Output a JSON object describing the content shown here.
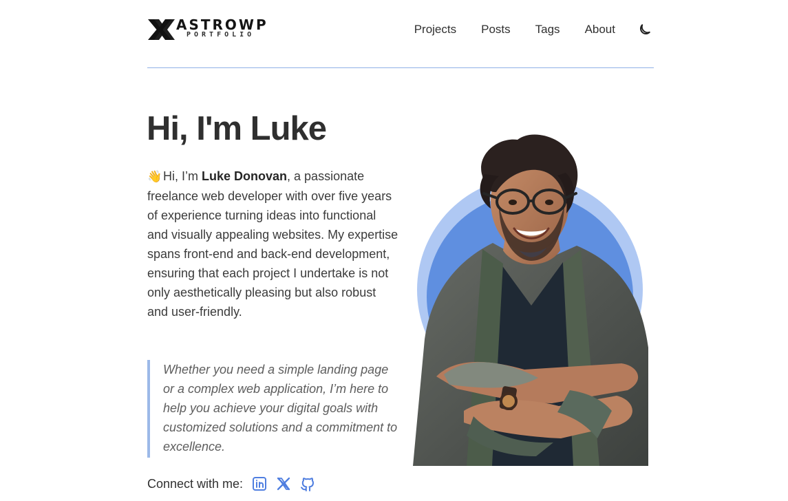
{
  "header": {
    "logo": {
      "mark": "X",
      "title": "ASTROWP",
      "subtitle": "PORTFOLIO"
    },
    "nav": [
      {
        "label": "Projects"
      },
      {
        "label": "Posts"
      },
      {
        "label": "Tags"
      },
      {
        "label": "About"
      }
    ],
    "theme_toggle_icon": "moon-icon"
  },
  "hero": {
    "title": "Hi, I'm Luke",
    "intro": {
      "emoji": "👋",
      "prefix": "Hi, I’m",
      "name": "Luke Donovan",
      "suffix": ", a passionate freelance web developer with over five years of experience turning ideas into functional and visually appealing websites. My expertise spans front-end and back-end development, ensuring that each project I undertake is not only aesthetically pleasing but also robust and user-friendly."
    },
    "quote": "Whether you need a simple landing page or a complex web application, I’m here to help you achieve your digital goals with customized solutions and a commitment to excellence."
  },
  "connect": {
    "label": "Connect with me:",
    "links": [
      {
        "icon": "linkedin-icon"
      },
      {
        "icon": "x-icon"
      },
      {
        "icon": "github-icon"
      }
    ]
  },
  "colors": {
    "accent": "#3f6fd8",
    "accent_light": "#afc8f3",
    "divider": "#8fb1e6",
    "text": "#2f2f2f"
  }
}
